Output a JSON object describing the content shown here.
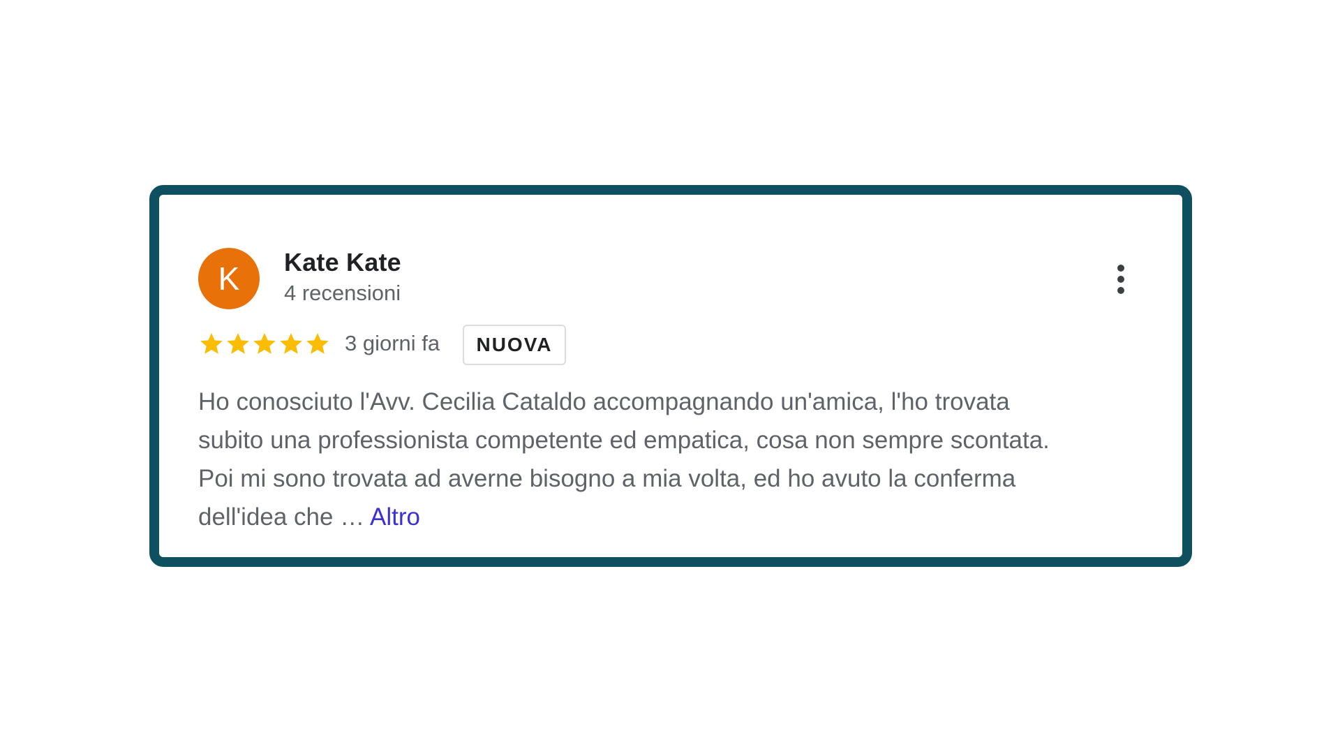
{
  "review": {
    "avatar_letter": "K",
    "author_name": "Kate Kate",
    "review_count": "4 recensioni",
    "rating": 5,
    "max_rating": 5,
    "timestamp": "3 giorni fa",
    "badge": "NUOVA",
    "text_lines": [
      "Ho conosciuto l'Avv. Cecilia Cataldo accompagnando un'amica, l'ho trovata",
      "subito una professionista competente ed empatica, cosa non sempre scontata.",
      "Poi mi sono trovata ad averne bisogno a mia volta, ed ho avuto la conferma",
      "dell'idea che …"
    ],
    "more_link": "Altro"
  },
  "icons": {
    "menu": "more-vert-icon",
    "star": "star-icon"
  },
  "colors": {
    "card_border": "#0f5060",
    "avatar_bg": "#e8710a",
    "star": "#fbbc04",
    "link": "#3b2fd6",
    "muted_text": "#5f6368"
  }
}
